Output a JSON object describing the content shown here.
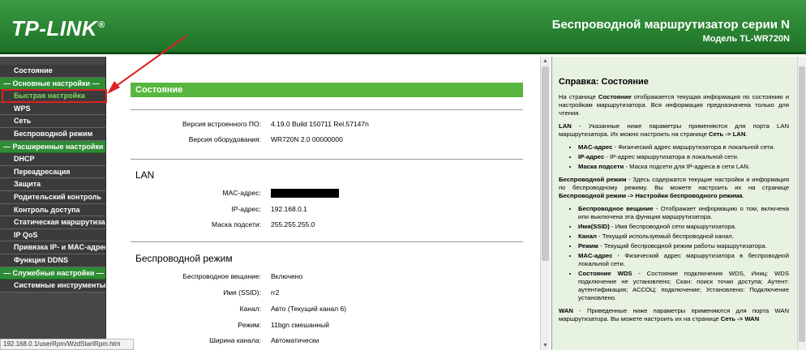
{
  "header": {
    "logo": "TP-LINK",
    "logo_mark": "®",
    "title": "Беспроводной маршрутизатор серии N",
    "model": "Модель TL-WR720N"
  },
  "sidebar": {
    "items": [
      {
        "label": "Состояние",
        "type": "item"
      },
      {
        "label": "— Основные настройки —",
        "type": "header"
      },
      {
        "label": "Быстрая настройка",
        "type": "item",
        "active": true
      },
      {
        "label": "WPS",
        "type": "item"
      },
      {
        "label": "Сеть",
        "type": "item"
      },
      {
        "label": "Беспроводной режим",
        "type": "item"
      },
      {
        "label": "— Расширенные настройки —",
        "type": "header"
      },
      {
        "label": "DHCP",
        "type": "item"
      },
      {
        "label": "Переадресация",
        "type": "item"
      },
      {
        "label": "Защита",
        "type": "item"
      },
      {
        "label": "Родительский контроль",
        "type": "item"
      },
      {
        "label": "Контроль доступа",
        "type": "item"
      },
      {
        "label": "Статическая маршрутизация",
        "type": "item"
      },
      {
        "label": "IP QoS",
        "type": "item"
      },
      {
        "label": "Привязка IP- и MAC-адресов",
        "type": "item"
      },
      {
        "label": "Функция DDNS",
        "type": "item"
      },
      {
        "label": "— Служебные настройки —",
        "type": "header"
      },
      {
        "label": "Системные инструменты",
        "type": "item"
      }
    ]
  },
  "main": {
    "title": "Состояние",
    "firmware_label": "Версия встроенного ПО:",
    "firmware_value": "4.19.0 Build 150711 Rel.57147n",
    "hardware_label": "Версия оборудования:",
    "hardware_value": "WR720N 2.0 00000000",
    "lan": {
      "title": "LAN",
      "mac_label": "MAC-адрес:",
      "ip_label": "IP-адрес:",
      "ip_value": "192.168.0.1",
      "mask_label": "Маска подсети:",
      "mask_value": "255.255.255.0"
    },
    "wireless": {
      "title": "Беспроводной режим",
      "broadcast_label": "Беспроводное вещание:",
      "broadcast_value": "Включено",
      "ssid_label": "Имя (SSID):",
      "ssid_value": "rr2",
      "channel_label": "Канал:",
      "channel_value": "Авто (Текущий канал 6)",
      "mode_label": "Режим:",
      "mode_value": "11bgn смешанный",
      "width_label": "Ширина канала:",
      "width_value": "Автоматически"
    }
  },
  "help": {
    "title": "Справка: Состояние",
    "intro_pre": "На странице ",
    "intro_bold": "Состояние",
    "intro_post": " отображается текущая информация по состоянию и настройкам маршрутизатора. Вся информация предназначена только для чтения.",
    "lan_bold": "LAN",
    "lan_text": " - Указанные ниже параметры применяются для порта LAN маршрутизатора. Их можно настроить на странице ",
    "lan_link": "Сеть -> LAN",
    "lan_items": [
      {
        "b": "MAC-адрес",
        "t": " - Физический адрес маршрутизатора в локальной сети."
      },
      {
        "b": "IP-адрес",
        "t": " - IP-адрес маршрутизатора в локальной сети."
      },
      {
        "b": "Маска подсети",
        "t": " - Маска подсети для IP-адреса в сети LAN."
      }
    ],
    "wl_bold": "Беспроводной режим",
    "wl_text": " - Здесь содержатся текущие настройки и информация по беспроводному режиму. Вы можете настроить их на странице ",
    "wl_link": "Беспроводной режим -> Настройки беспроводного режима",
    "wl_items": [
      {
        "b": "Беспроводное вещание",
        "t": " - Отображает информацию о том, включена или выключена эта функция маршрутизатора."
      },
      {
        "b": "Имя(SSID)",
        "t": " - Имя беспроводной сети маршрутизатора."
      },
      {
        "b": "Канал",
        "t": " - Текущий используемый беспроводной канал."
      },
      {
        "b": "Режим",
        "t": " - Текущий беспроводной режим работы маршрутизатора."
      },
      {
        "b": "MAC-адрес",
        "t": " - Физический адрес маршрутизатора в беспроводной локальной сети."
      },
      {
        "b": "Состояние WDS",
        "t": " - Состояние подключения WDS, Иниц: WDS подключение не установлено; Скан: поиск точки доступа; Аутент: аутентификация; АССОЦ: подключение; Установлено: Подключение установлено."
      }
    ],
    "wan_bold": "WAN",
    "wan_text": " - Приведенные ниже параметры применяются для порта WAN маршрутизатора. Вы можете настроить их на странице ",
    "wan_link": "Сеть -> WAN"
  },
  "status_url": "192.168.0.1/userRpm/WzdStartRpm.htm",
  "colors": {
    "brand_green": "#2a8432",
    "title_bar_green": "#57b63d",
    "sidebar_bg": "#474747",
    "help_bg": "#e8f2e1",
    "annotation_red": "#e02020"
  }
}
